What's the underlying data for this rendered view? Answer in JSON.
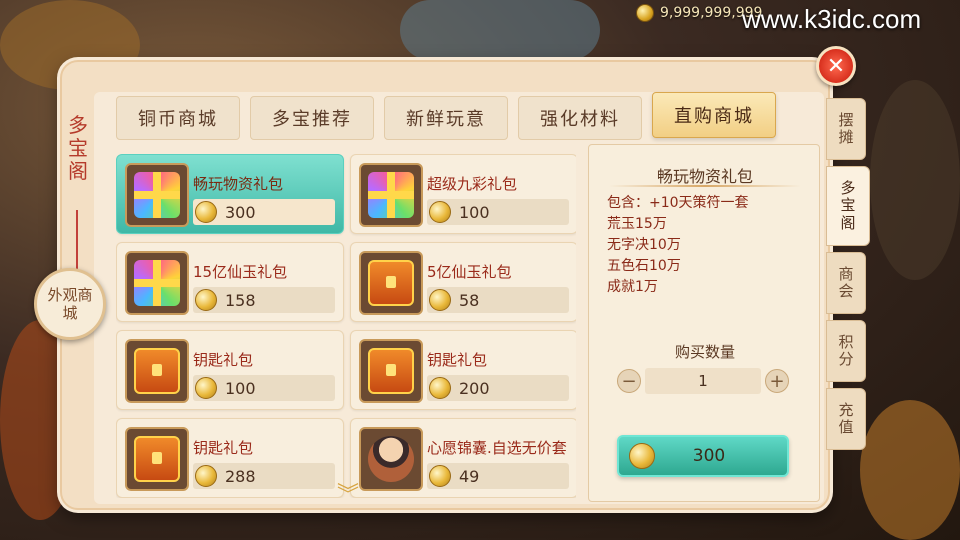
{
  "header": {
    "currency_amount": "9,999,999,999",
    "watermark": "www.k3idc.com"
  },
  "shop_title": "多宝阁",
  "outer_shop_label": "外观商城",
  "tabs": [
    {
      "label": "铜币商城",
      "active": false
    },
    {
      "label": "多宝推荐",
      "active": false
    },
    {
      "label": "新鲜玩意",
      "active": false
    },
    {
      "label": "强化材料",
      "active": false
    },
    {
      "label": "直购商城",
      "active": true
    }
  ],
  "items": [
    {
      "name": "畅玩物资礼包",
      "price": "300",
      "icon": "rainbow-gift-box-icon",
      "selected": true
    },
    {
      "name": "超级九彩礼包",
      "price": "100",
      "icon": "rainbow-gift-box-icon",
      "selected": false
    },
    {
      "name": "15亿仙玉礼包",
      "price": "158",
      "icon": "rainbow-gift-box-icon",
      "selected": false
    },
    {
      "name": "5亿仙玉礼包",
      "price": "58",
      "icon": "treasure-chest-icon",
      "selected": false
    },
    {
      "name": "钥匙礼包",
      "price": "100",
      "icon": "treasure-chest-icon",
      "selected": false
    },
    {
      "name": "钥匙礼包",
      "price": "200",
      "icon": "treasure-chest-icon",
      "selected": false
    },
    {
      "name": "钥匙礼包",
      "price": "288",
      "icon": "treasure-chest-icon",
      "selected": false
    },
    {
      "name": "心愿锦囊.自选无价套",
      "price": "49",
      "icon": "character-outfit-icon",
      "selected": false
    }
  ],
  "detail": {
    "title": "畅玩物资礼包",
    "lines": [
      "包含：+10天策符一套",
      "荒玉15万",
      "无字决10万",
      "五色石10万",
      "成就1万"
    ],
    "quantity_label": "购买数量",
    "quantity": "1",
    "minus": "−",
    "plus": "+",
    "buy_price": "300"
  },
  "side_tabs": [
    {
      "label": "摆摊",
      "active": false
    },
    {
      "label": "多宝阁",
      "active": true
    },
    {
      "label": "商会",
      "active": false
    },
    {
      "label": "积分",
      "active": false
    },
    {
      "label": "充值",
      "active": false
    }
  ],
  "close_symbol": "✕",
  "scroll_symbol": "︾",
  "colors": {
    "accent_teal": "#3fb8a6",
    "title_red": "#b53a2a",
    "panel": "#f3dfc4"
  }
}
